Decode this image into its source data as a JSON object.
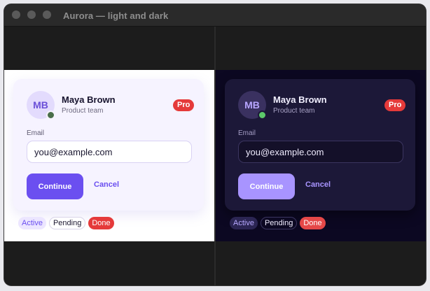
{
  "window": {
    "title": "Aurora — light and dark"
  },
  "panes": {
    "light": {
      "avatar_initials": "MB",
      "name": "Maya Brown",
      "team": "Product team",
      "badge": "Pro",
      "email_label": "Email",
      "email_value": "you@example.com",
      "continue_label": "Continue",
      "cancel_label": "Cancel",
      "chips": {
        "active": "Active",
        "pending": "Pending",
        "done": "Done"
      }
    },
    "dark": {
      "avatar_initials": "MB",
      "name": "Maya Brown",
      "team": "Product team",
      "badge": "Pro",
      "email_label": "Email",
      "email_value": "you@example.com",
      "continue_label": "Continue",
      "cancel_label": "Cancel",
      "chips": {
        "active": "Active",
        "pending": "Pending",
        "done": "Done"
      }
    }
  },
  "colors": {
    "accent": "#6b4ff0",
    "accent_dark": "#a894ff",
    "danger": "#e53a3a",
    "presence_online": "#5cc96a"
  }
}
